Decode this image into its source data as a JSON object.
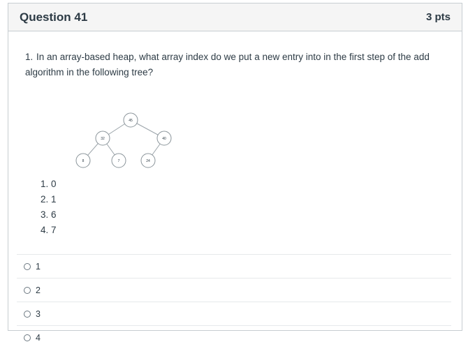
{
  "question": {
    "title": "Question 41",
    "points": "3 pts",
    "prompt_number": "1.",
    "prompt_text": "In an array-based heap, what array index do we put a new entry into in the first step of the add algorithm in the following tree?",
    "tree_nodes": [
      "45",
      "32",
      "40",
      "8",
      "7",
      "24"
    ],
    "choices": [
      "1. 0",
      "2. 1",
      "3. 6",
      "4. 7"
    ]
  },
  "answers": [
    "1",
    "2",
    "3",
    "4"
  ],
  "colors": {
    "border": "#c7cdd1",
    "header_bg": "#f5f5f5",
    "text": "#2d3b45"
  }
}
